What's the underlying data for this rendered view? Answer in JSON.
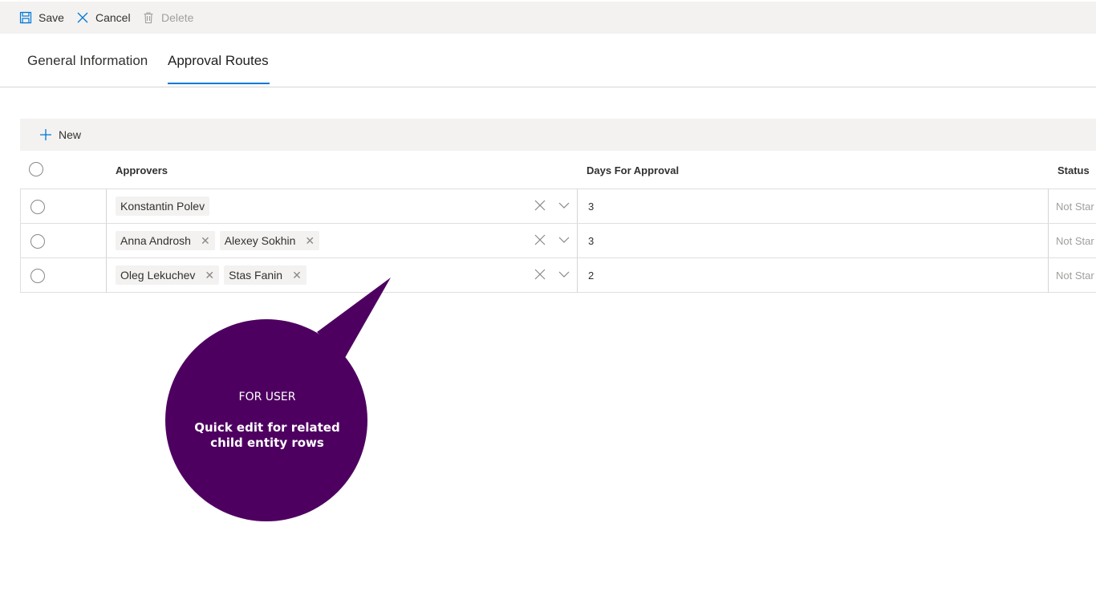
{
  "toolbar": {
    "save_label": "Save",
    "cancel_label": "Cancel",
    "delete_label": "Delete"
  },
  "tabs": [
    {
      "label": "General Information",
      "active": false
    },
    {
      "label": "Approval Routes",
      "active": true
    }
  ],
  "grid": {
    "new_label": "New",
    "columns": [
      "Approvers",
      "Days For Approval",
      "Status"
    ],
    "rows": [
      {
        "approvers": [
          "Konstantin Polev"
        ],
        "days": "3",
        "status": "Not Star"
      },
      {
        "approvers": [
          "Anna Androsh",
          "Alexey Sokhin"
        ],
        "days": "3",
        "status": "Not Star"
      },
      {
        "approvers": [
          "Oleg Lekuchev",
          "Stas Fanin"
        ],
        "days": "2",
        "status": "Not Star"
      }
    ]
  },
  "callout": {
    "title": "FOR USER",
    "body_line1": "Quick edit for related",
    "body_line2": "child entity rows",
    "color": "#4e0060"
  },
  "colors": {
    "accent": "#0078d4",
    "toolbar_bg": "#f3f2f1"
  }
}
